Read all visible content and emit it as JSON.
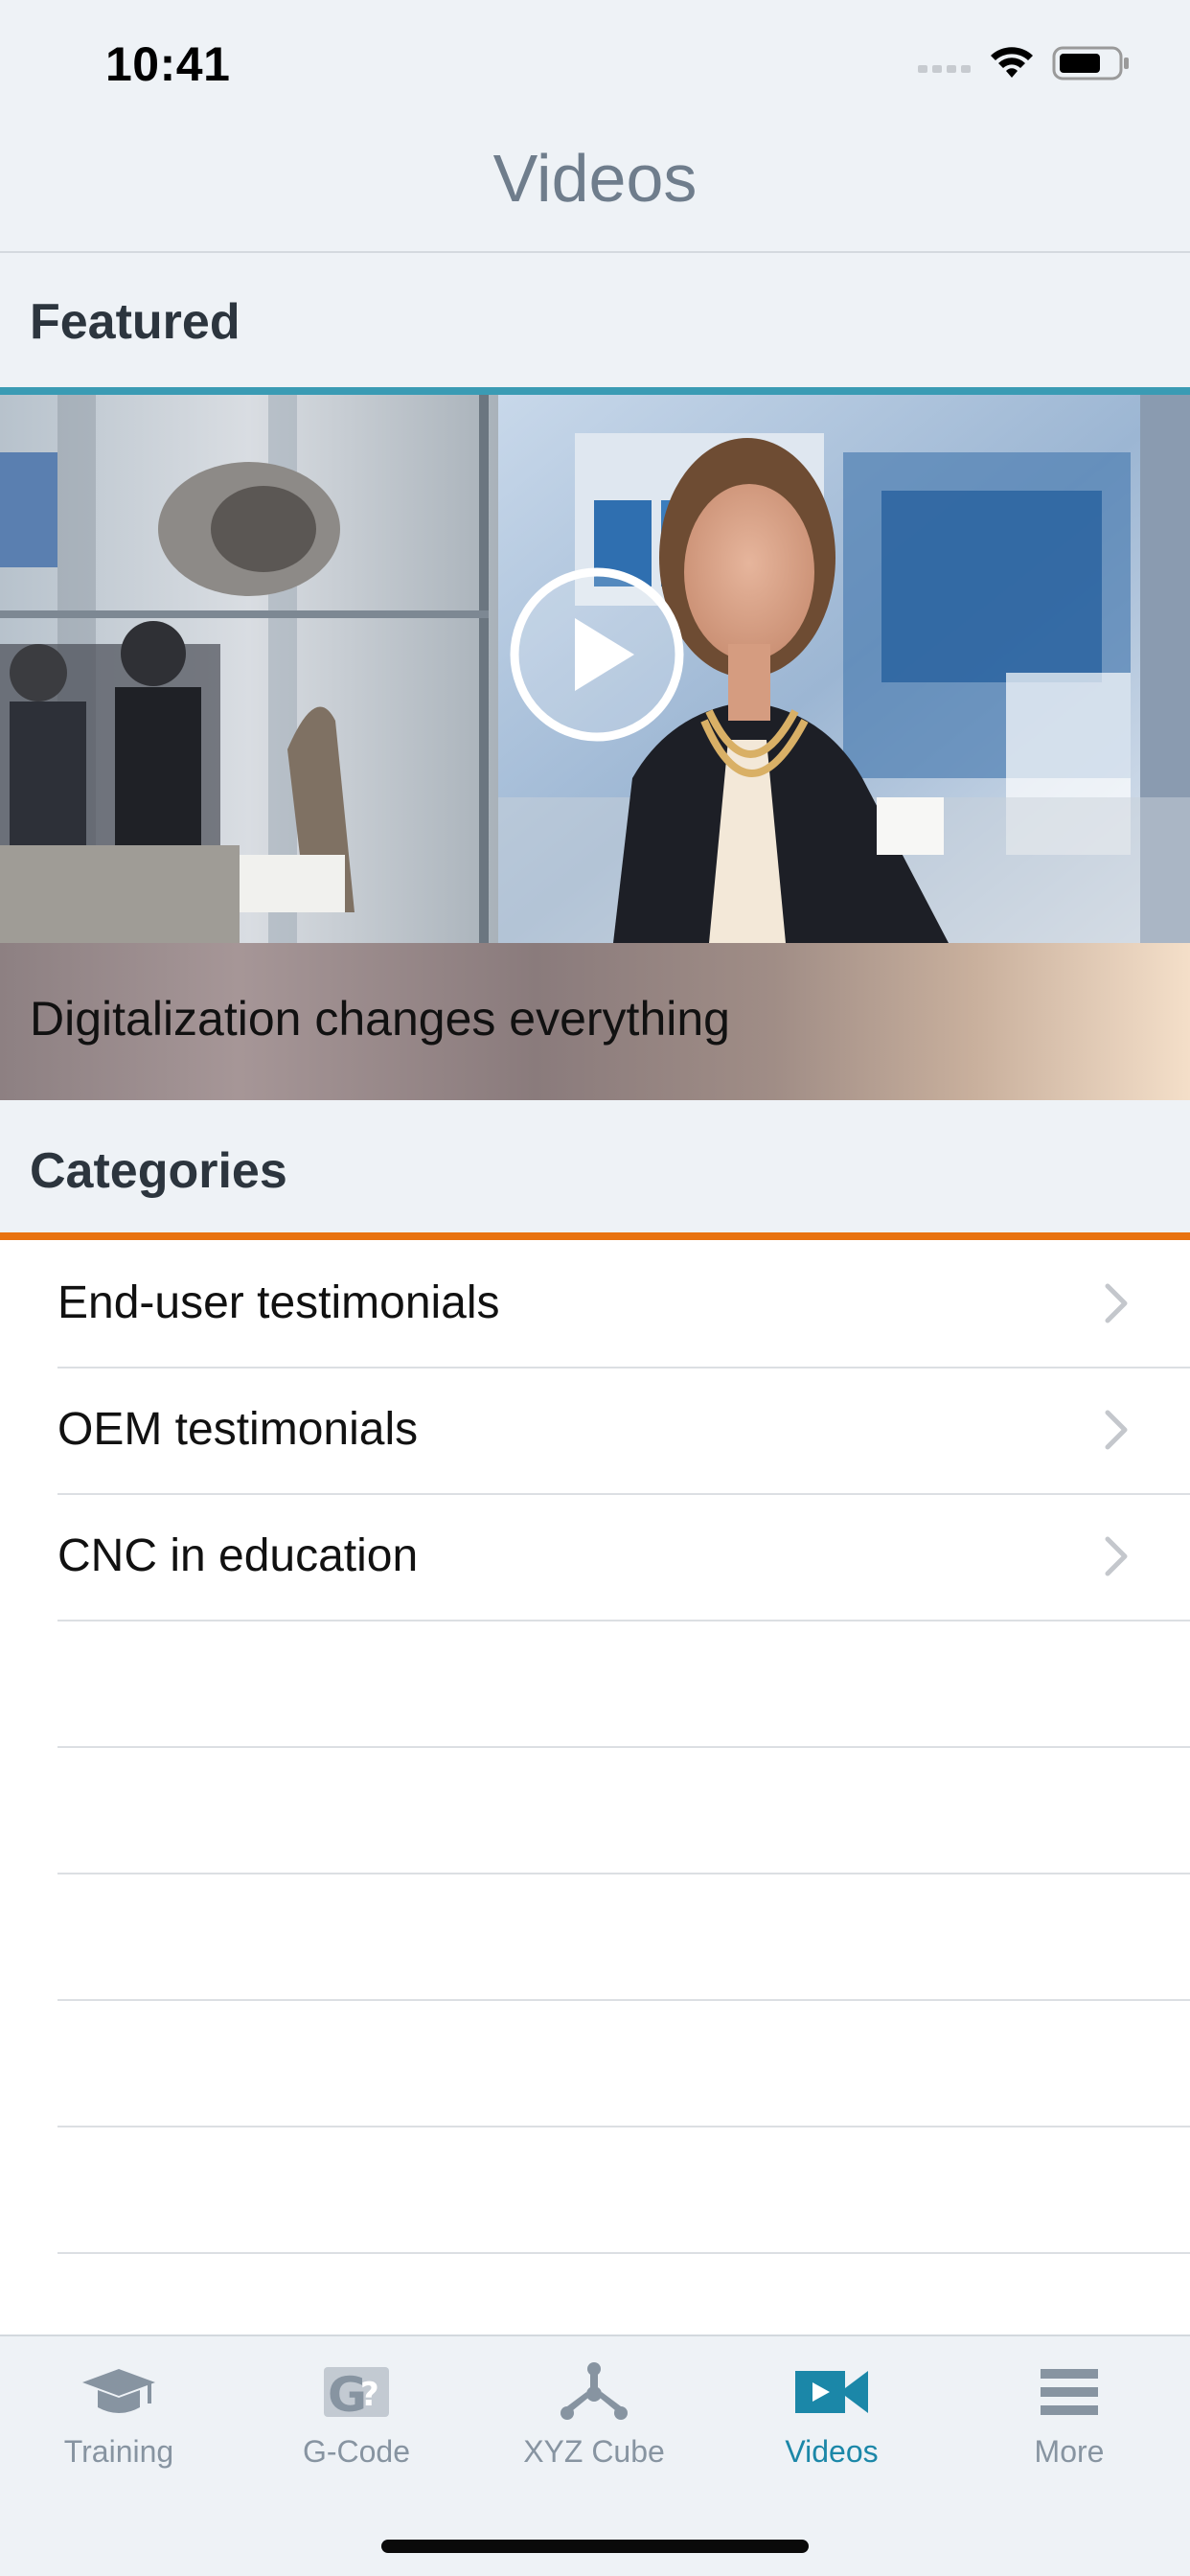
{
  "status_bar": {
    "time": "10:41",
    "icons": [
      "signal-icon",
      "wifi-icon",
      "battery-icon"
    ]
  },
  "nav": {
    "title": "Videos"
  },
  "featured": {
    "header": "Featured",
    "video_caption": "Digitalization changes everything",
    "play_icon": "play-icon"
  },
  "categories": {
    "header": "Categories",
    "items": [
      {
        "label": "End-user testimonials"
      },
      {
        "label": "OEM testimonials"
      },
      {
        "label": "CNC in education"
      }
    ]
  },
  "tab_bar": {
    "tabs": [
      {
        "label": "Training",
        "icon": "graduation-cap-icon",
        "active": false
      },
      {
        "label": "G-Code",
        "icon": "gcode-icon",
        "active": false
      },
      {
        "label": "XYZ Cube",
        "icon": "xyz-cube-icon",
        "active": false
      },
      {
        "label": "Videos",
        "icon": "video-camera-icon",
        "active": true
      },
      {
        "label": "More",
        "icon": "menu-icon",
        "active": false
      }
    ]
  },
  "colors": {
    "accent_teal": "#3a9bb4",
    "accent_orange": "#e8730f",
    "active_tab": "#1b87a8",
    "inactive_tab": "#8794a1"
  }
}
